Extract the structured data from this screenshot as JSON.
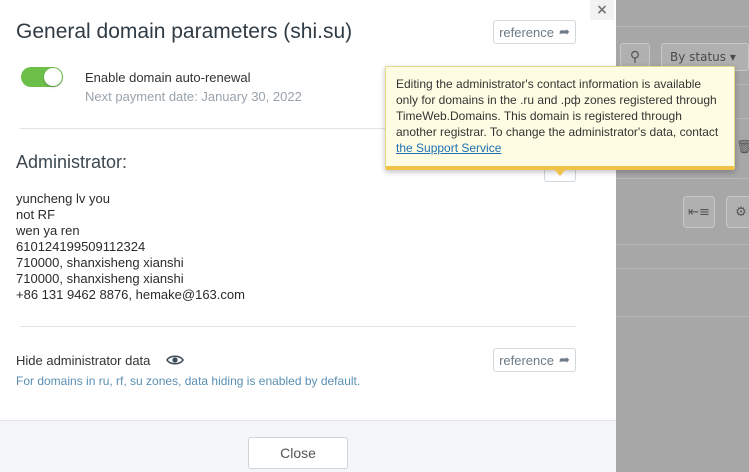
{
  "modal": {
    "title": "General domain parameters (shi.su)",
    "reference_label": "reference",
    "close_x": "×",
    "auto_renewal": {
      "label": "Enable domain auto-renewal",
      "next_payment": "Next payment date: January 30, 2022",
      "enabled": true
    },
    "administrator": {
      "heading": "Administrator:",
      "lines": [
        "yuncheng lv you",
        "not RF",
        "wen ya ren",
        "610124199509112324",
        "710000, shanxisheng xianshi",
        "710000, shanxisheng xianshi",
        "+86 131 9462 8876, hemake@163.com"
      ]
    },
    "hide_data": {
      "label": "Hide administrator data",
      "note": "For domains in ru, rf, su zones, data hiding is enabled by default.",
      "icon": "eye-icon"
    },
    "close_button": "Close"
  },
  "tooltip": {
    "text": "Editing the administrator's contact information is available only for domains in the .ru and .рф zones registered through TimeWeb.Domains. This domain is registered through another registrar. To change the administrator's data, contact ",
    "link": "the Support Service"
  },
  "background": {
    "status_filter": "By status",
    "search_icon": "search-icon"
  },
  "colors": {
    "toggle_on": "#6cc04a",
    "link": "#1f6fb2",
    "tooltip_bg": "#fefde3",
    "tooltip_border": "#f0c24a"
  }
}
